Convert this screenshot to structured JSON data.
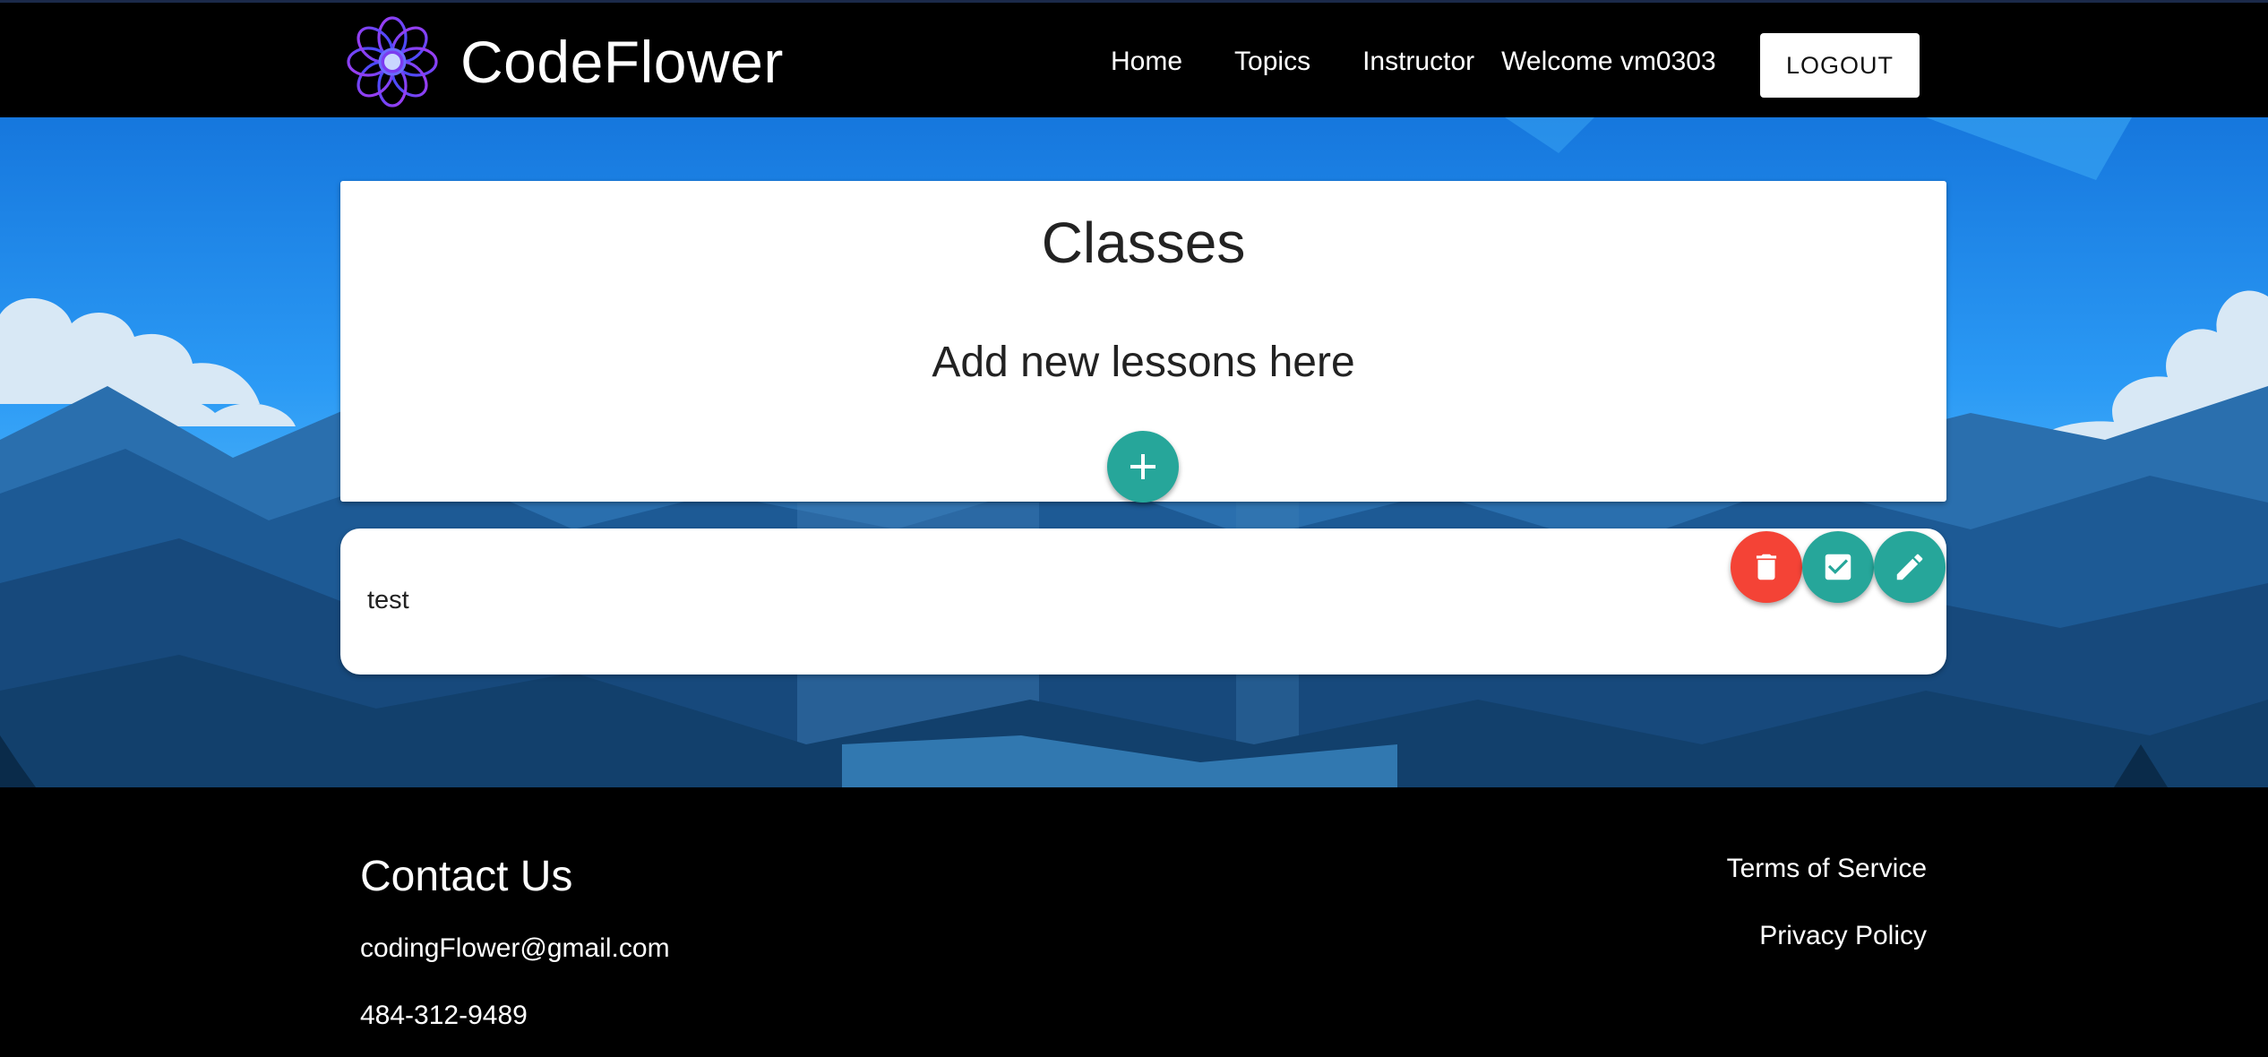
{
  "navbar": {
    "brand_name": "CodeFlower",
    "links": [
      {
        "label": "Home"
      },
      {
        "label": "Topics"
      },
      {
        "label": "Instructor"
      }
    ],
    "welcome_text": "Welcome vm0303",
    "logout_label": "LOGOUT"
  },
  "classes": {
    "title": "Classes",
    "subtitle": "Add new lessons here",
    "add_icon": "plus-icon"
  },
  "lessons": [
    {
      "title": "test",
      "actions": [
        "trash-icon",
        "checkbox-icon",
        "pencil-icon"
      ]
    }
  ],
  "footer": {
    "contact_title": "Contact Us",
    "email": "codingFlower@gmail.com",
    "phone": "484-312-9489",
    "terms_label": "Terms of Service",
    "privacy_label": "Privacy Policy"
  },
  "colors": {
    "teal_accent": "#26a69a",
    "delete_red": "#f44336",
    "logo_purple": "#8e3cf0",
    "logo_blue": "#3b5bff"
  }
}
